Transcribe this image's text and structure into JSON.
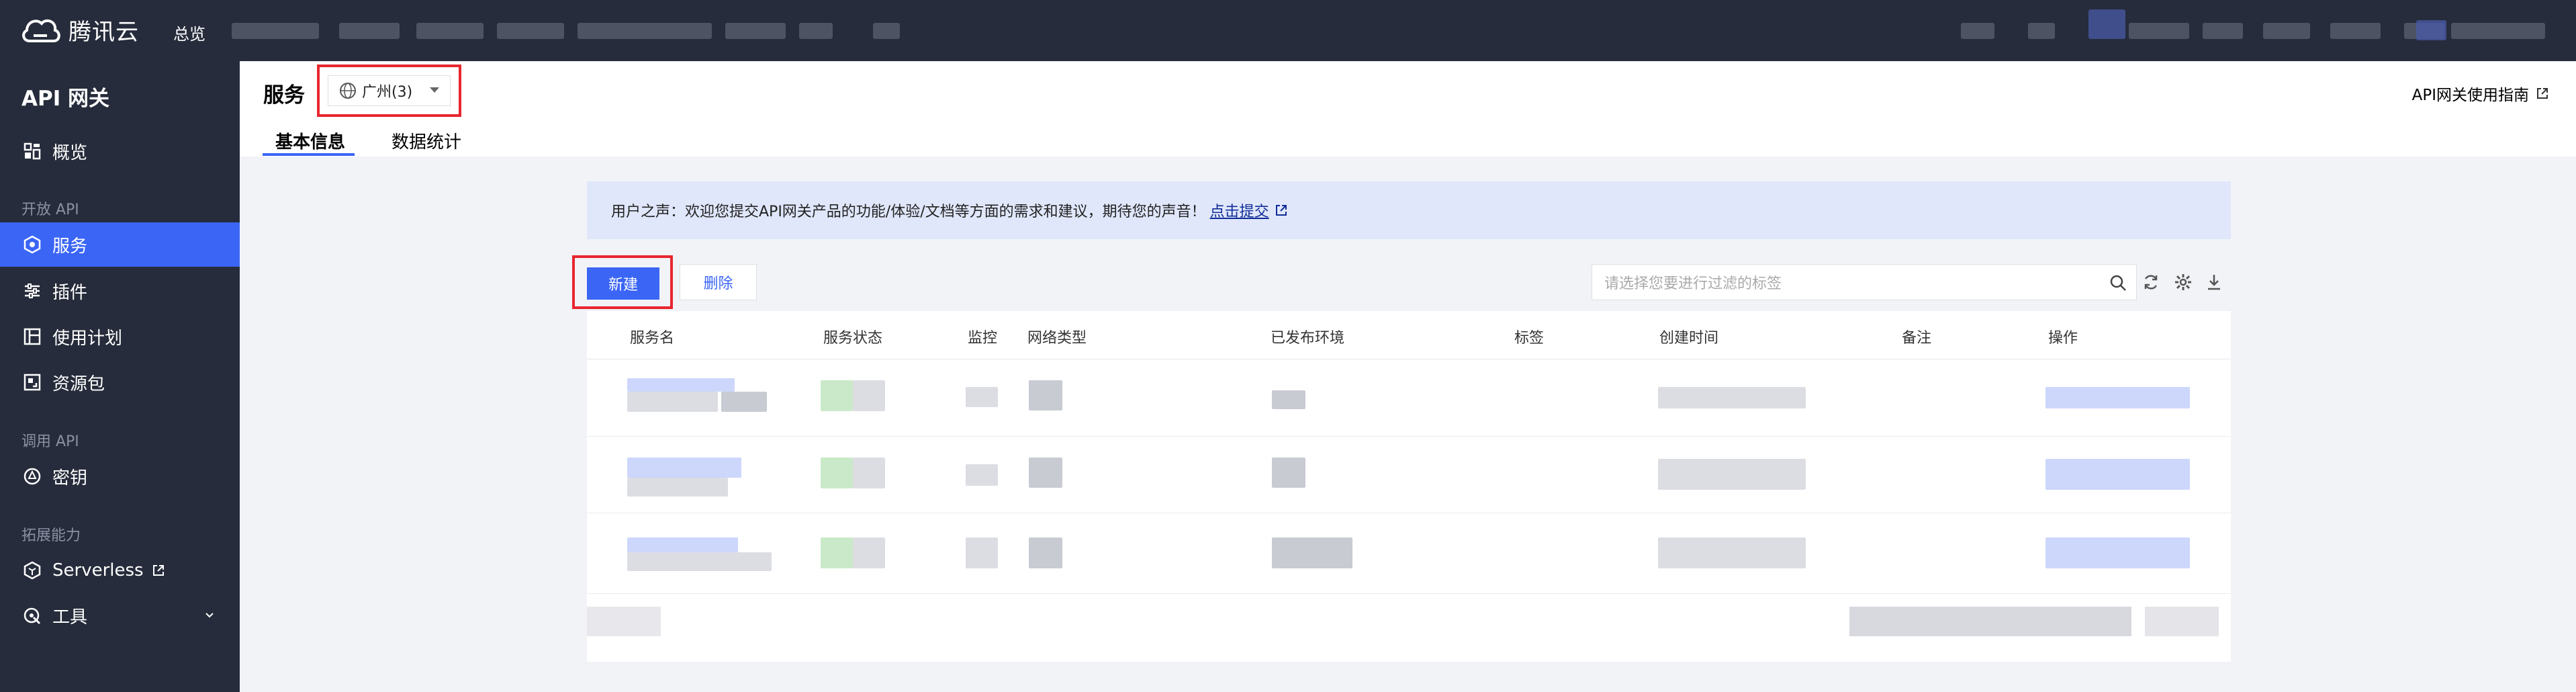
{
  "topbar": {
    "brand": "腾讯云",
    "overview": "总览"
  },
  "sidebar": {
    "title": "API 网关",
    "overview": "概览",
    "group_open_api": "开放 API",
    "item_service": "服务",
    "item_plugin": "插件",
    "item_usage_plan": "使用计划",
    "item_resource_pack": "资源包",
    "group_call_api": "调用 API",
    "item_key": "密钥",
    "group_extension": "拓展能力",
    "item_serverless": "Serverless",
    "item_tools": "工具"
  },
  "header": {
    "title": "服务",
    "region": "广州(3)",
    "guide_link": "API网关使用指南",
    "tabs": [
      "基本信息",
      "数据统计"
    ]
  },
  "notice": {
    "text": "用户之声：欢迎您提交API网关产品的功能/体验/文档等方面的需求和建议，期待您的声音！",
    "link": "点击提交"
  },
  "toolbar": {
    "new_label": "新建",
    "delete_label": "删除",
    "search_placeholder": "请选择您要进行过滤的标签"
  },
  "table": {
    "columns": [
      "服务名",
      "服务状态",
      "监控",
      "网络类型",
      "已发布环境",
      "标签",
      "创建时间",
      "备注",
      "操作"
    ]
  },
  "colors": {
    "accent": "#3a65f5",
    "highlight": "#e8262e",
    "topbar": "#262c3b"
  }
}
